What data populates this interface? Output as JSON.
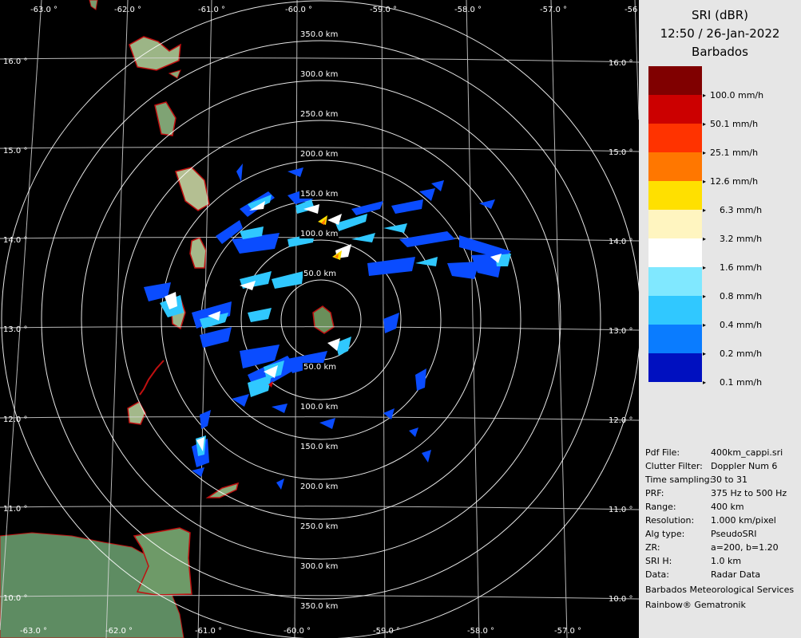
{
  "header": {
    "product": "SRI (dBR)",
    "datetime": "12:50 / 26-Jan-2022",
    "site": "Barbados"
  },
  "longitude_labels": [
    "-63.0 °",
    "-62.0 °",
    "-61.0 °",
    "-60.0 °",
    "-59.0 °",
    "-58.0 °",
    "-57.0 °",
    "-56"
  ],
  "latitude_labels": [
    "16.0 °",
    "15.0 °",
    "14.0 °",
    "13.0 °",
    "12.0 °",
    "11.0 °",
    "10.0 °"
  ],
  "range_labels_north": [
    "350.0 km",
    "300.0 km",
    "250.0 km",
    "200.0 km",
    "150.0 km",
    "100.0 km",
    "50.0 km"
  ],
  "range_labels_south": [
    "50.0 km",
    "100.0 km",
    "150.0 km",
    "200.0 km",
    "250.0 km",
    "300.0 km",
    "350.0 km"
  ],
  "legend": [
    {
      "color": "#800000",
      "label": "100.0 mm/h"
    },
    {
      "color": "#cc0000",
      "label": "50.1 mm/h"
    },
    {
      "color": "#ff3300",
      "label": "25.1 mm/h"
    },
    {
      "color": "#ff7700",
      "label": "12.6 mm/h"
    },
    {
      "color": "#ffe000",
      "label": "6.3 mm/h"
    },
    {
      "color": "#fff5c0",
      "label": "3.2 mm/h"
    },
    {
      "color": "#ffffff",
      "label": "1.6 mm/h"
    },
    {
      "color": "#80e8ff",
      "label": "0.8 mm/h"
    },
    {
      "color": "#30c8ff",
      "label": "0.4 mm/h"
    },
    {
      "color": "#0a7cff",
      "label": "0.2 mm/h"
    },
    {
      "color": "#0010c0",
      "label": "0.1 mm/h"
    }
  ],
  "info": [
    {
      "key": "Pdf File:",
      "value": "400km_cappi.sri"
    },
    {
      "key": "Clutter Filter:",
      "value": "Doppler Num 6"
    },
    {
      "key": "Time sampling:",
      "value": "30 to 31"
    },
    {
      "key": "PRF:",
      "value": "375 Hz to 500 Hz"
    },
    {
      "key": "Range:",
      "value": "400 km"
    },
    {
      "key": "Resolution:",
      "value": "1.000 km/pixel"
    },
    {
      "key": "Alg type:",
      "value": "PseudoSRI"
    },
    {
      "key": "ZR:",
      "value": "a=200, b=1.20"
    },
    {
      "key": "SRI H:",
      "value": "1.0 km"
    },
    {
      "key": "Data:",
      "value": "Radar Data"
    }
  ],
  "footer": {
    "org": "Barbados Meteorological Services",
    "software": "Rainbow® Gematronik"
  }
}
